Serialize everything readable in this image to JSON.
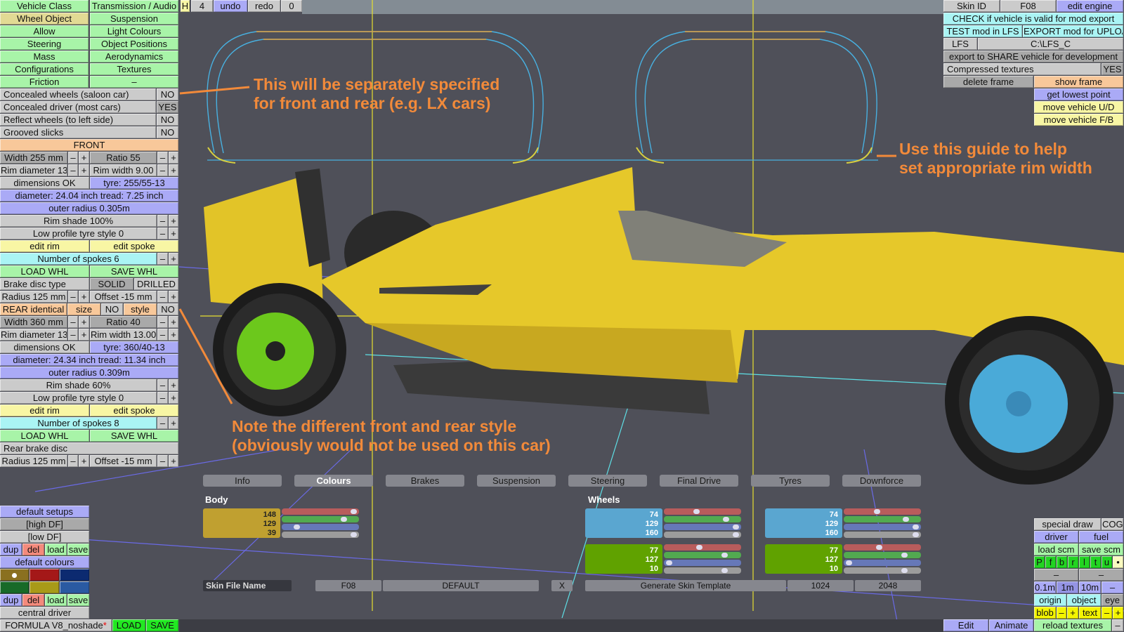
{
  "ui": {
    "minus": "–",
    "plus": "+"
  },
  "menu": [
    "Vehicle Class",
    "Transmission / Audio",
    "Wheel Object",
    "Suspension",
    "Allow",
    "Light Colours",
    "Steering",
    "Object Positions",
    "Mass",
    "Aerodynamics",
    "Configurations",
    "Textures",
    "Friction",
    "–"
  ],
  "menu_selected": "Wheel Object",
  "topbar": {
    "h": "H",
    "count": "4",
    "undo": "undo",
    "redo": "redo",
    "redo_count": "0"
  },
  "options": [
    {
      "label": "Concealed wheels (saloon car)",
      "value": "NO"
    },
    {
      "label": "Concealed driver (most cars)",
      "value": "YES"
    },
    {
      "label": "Reflect wheels (to left side)",
      "value": "NO"
    },
    {
      "label": "Grooved slicks",
      "value": "NO"
    }
  ],
  "front": {
    "header": "FRONT",
    "width": "Width 255 mm",
    "ratio": "Ratio 55",
    "rim_diameter": "Rim diameter 13",
    "rim_width": "Rim width 9.00",
    "dimensions": "dimensions OK",
    "tyre": "tyre: 255/55-13",
    "diameter_tread": "diameter: 24.04 inch   tread: 7.25 inch",
    "outer_radius": "outer radius 0.305m",
    "rim_shade": "Rim shade 100%",
    "low_profile": "Low profile tyre style 0",
    "edit_rim": "edit rim",
    "edit_spoke": "edit spoke",
    "spokes": "Number of spokes 6",
    "load_whl": "LOAD WHL",
    "save_whl": "SAVE WHL",
    "brake_disc": "Brake disc type",
    "solid": "SOLID",
    "drilled": "DRILLED",
    "radius": "Radius 125 mm",
    "offset": "Offset -15 mm"
  },
  "rear_identical": {
    "label": "REAR identical",
    "size": "size",
    "size_value": "NO",
    "style": "style",
    "style_value": "NO"
  },
  "rear": {
    "width": "Width 360 mm",
    "ratio": "Ratio 40",
    "rim_diameter": "Rim diameter 13",
    "rim_width": "Rim width 13.00",
    "dimensions": "dimensions OK",
    "tyre": "tyre: 360/40-13",
    "diameter_tread": "diameter: 24.34 inch   tread: 11.34 inch",
    "outer_radius": "outer radius 0.309m",
    "rim_shade": "Rim shade 60%",
    "low_profile": "Low profile tyre style 0",
    "edit_rim": "edit rim",
    "edit_spoke": "edit spoke",
    "spokes": "Number of spokes 8",
    "load_whl": "LOAD WHL",
    "save_whl": "SAVE WHL",
    "brake_disc": "Rear brake disc",
    "radius": "Radius 125 mm",
    "offset": "Offset -15 mm"
  },
  "setups": {
    "default_setups": "default setups",
    "high_df": "[high DF]",
    "low_df": "[low DF]",
    "dup": "dup",
    "del": "del",
    "load": "load",
    "save": "save",
    "default_colours": "default colours",
    "central_driver": "central driver",
    "vehicle_name": "FORMULA V8_noshade",
    "modified_mark": "*",
    "load_btn": "LOAD",
    "save_btn": "SAVE",
    "swatches": [
      "#8a7020",
      "#a41818",
      "#0c2a70",
      "#186a28",
      "#a89a18",
      "#2a5aa2"
    ]
  },
  "right": {
    "skin_id": "Skin ID",
    "skin_value": "F08",
    "edit_engine": "edit engine",
    "check": "CHECK if vehicle is valid for mod export",
    "test": "TEST mod in LFS",
    "export": "EXPORT mod for UPLOAD",
    "lfs": "LFS",
    "lfs_path": "C:\\LFS_C",
    "share": "export to SHARE vehicle for development",
    "compressed": "Compressed textures",
    "compressed_value": "YES",
    "delete_frame": "delete frame",
    "show_frame": "show frame",
    "lowest_point": "get lowest point",
    "move_ud": "move vehicle U/D",
    "move_fb": "move vehicle F/B"
  },
  "tools": {
    "special_draw": "special draw",
    "cog": "COG",
    "driver": "driver",
    "fuel": "fuel",
    "load_scm": "load scm",
    "save_scm": "save scm",
    "flags": [
      "P",
      "f",
      "b",
      "r",
      "l",
      "t",
      "u",
      "•"
    ],
    "dash1": "–",
    "dash2": "–",
    "grid": [
      "0.1m",
      "1m",
      "10m",
      "–"
    ],
    "origin": "origin",
    "object": "object",
    "eye": "eye",
    "blob": "blob",
    "text": "text",
    "reload": "reload textures",
    "edit": "Edit",
    "animate": "Animate"
  },
  "skin": {
    "tabs": [
      "Info",
      "Colours",
      "Brakes",
      "Suspension",
      "Steering",
      "Final Drive",
      "Tyres",
      "Downforce"
    ],
    "active_tab": "Colours",
    "body_label": "Body",
    "wheels_label": "Wheels",
    "body": {
      "color": "#c0a030",
      "values": [
        "148",
        "129",
        "39"
      ],
      "sliders": [
        0.93,
        0.8,
        0.19,
        0.93
      ]
    },
    "wheels": [
      {
        "color": "#5aa6d0",
        "values": [
          "74",
          "129",
          "160"
        ],
        "sliders": [
          0.42,
          0.8,
          0.93,
          0.93
        ]
      },
      {
        "color": "#60a200",
        "values": [
          "77",
          "127",
          "10"
        ],
        "sliders": [
          0.45,
          0.78,
          0.06,
          0.78
        ]
      },
      {
        "color": "#5aa6d0",
        "values": [
          "74",
          "129",
          "160"
        ],
        "sliders": [
          0.43,
          0.8,
          0.93,
          0.93
        ]
      },
      {
        "color": "#60a200",
        "values": [
          "77",
          "127",
          "10"
        ],
        "sliders": [
          0.45,
          0.78,
          0.06,
          0.78
        ]
      }
    ],
    "file_name_label": "Skin File Name",
    "file_name": "F08",
    "default": "DEFAULT",
    "x": "X",
    "generate": "Generate Skin Template",
    "res1": "1024",
    "res2": "2048"
  },
  "annotations": {
    "rim_note": [
      "This will be separately specified",
      "for front and rear (e.g. LX cars)"
    ],
    "guide_note": [
      "Use this guide to help",
      "set appropriate rim width"
    ],
    "style_note": [
      "Note the different front and rear style",
      "(obviously would not be used on this car)"
    ]
  },
  "colors": {
    "accent_orange": "#f28a3a",
    "car_yellow": "#e8c828",
    "front_rim": "#6cc81c",
    "rear_rim": "#4aaad8"
  }
}
